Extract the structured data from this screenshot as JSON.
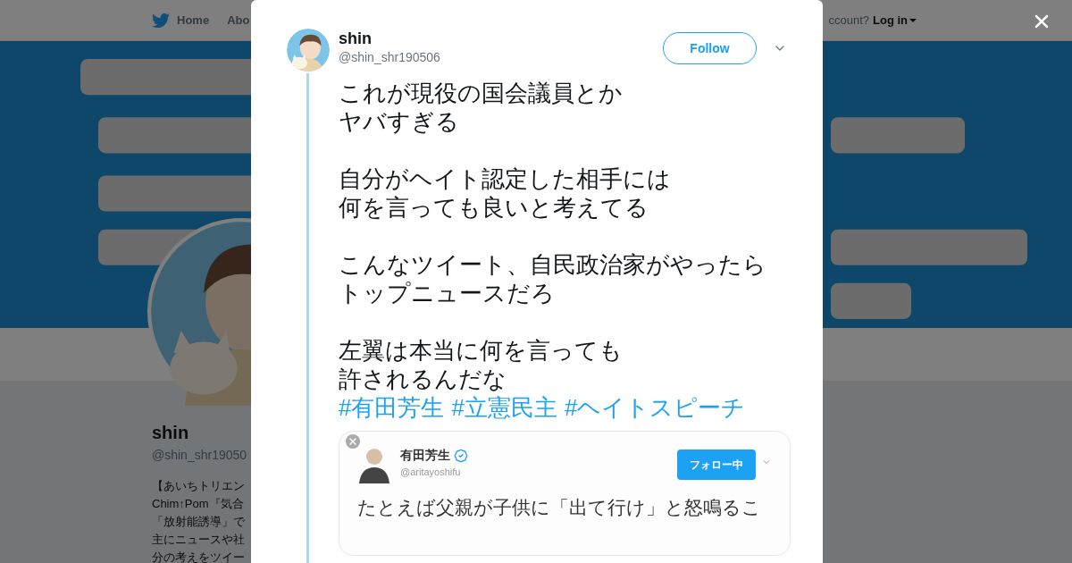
{
  "nav": {
    "items": [
      {
        "label": "Home"
      },
      {
        "label": "Abo"
      }
    ],
    "login_prompt": "ccount?",
    "login": "Log in"
  },
  "profile": {
    "name": "shin",
    "handle": "@shin_shr19050",
    "bio": [
      "【あいちトリエン",
      "Chim↑Pom『気合",
      "「放射能誘導」で",
      "主にニュースや社",
      "分の考えをツイー"
    ]
  },
  "tweet": {
    "name": "shin",
    "handle": "@shin_shr190506",
    "follow": "Follow",
    "paragraphs": [
      [
        "これが現役の国会議員とか",
        "ヤバすぎる"
      ],
      [
        "自分がヘイト認定した相手には",
        "何を言っても良いと考えてる"
      ],
      [
        "こんなツイート、自民政治家がやったら",
        "トップニュースだろ"
      ],
      [
        "左翼は本当に何を言っても",
        "許されるんだな"
      ]
    ],
    "hashtags": [
      "#有田芳生",
      "#立憲民主",
      "#ヘイトスピーチ"
    ],
    "screenshot": {
      "name": "有田芳生",
      "verified": true,
      "handle": "@aritayoshifu",
      "button": "フォロー中",
      "text": "たとえば父親が子供に「出て行け」と怒鳴るこ"
    }
  }
}
